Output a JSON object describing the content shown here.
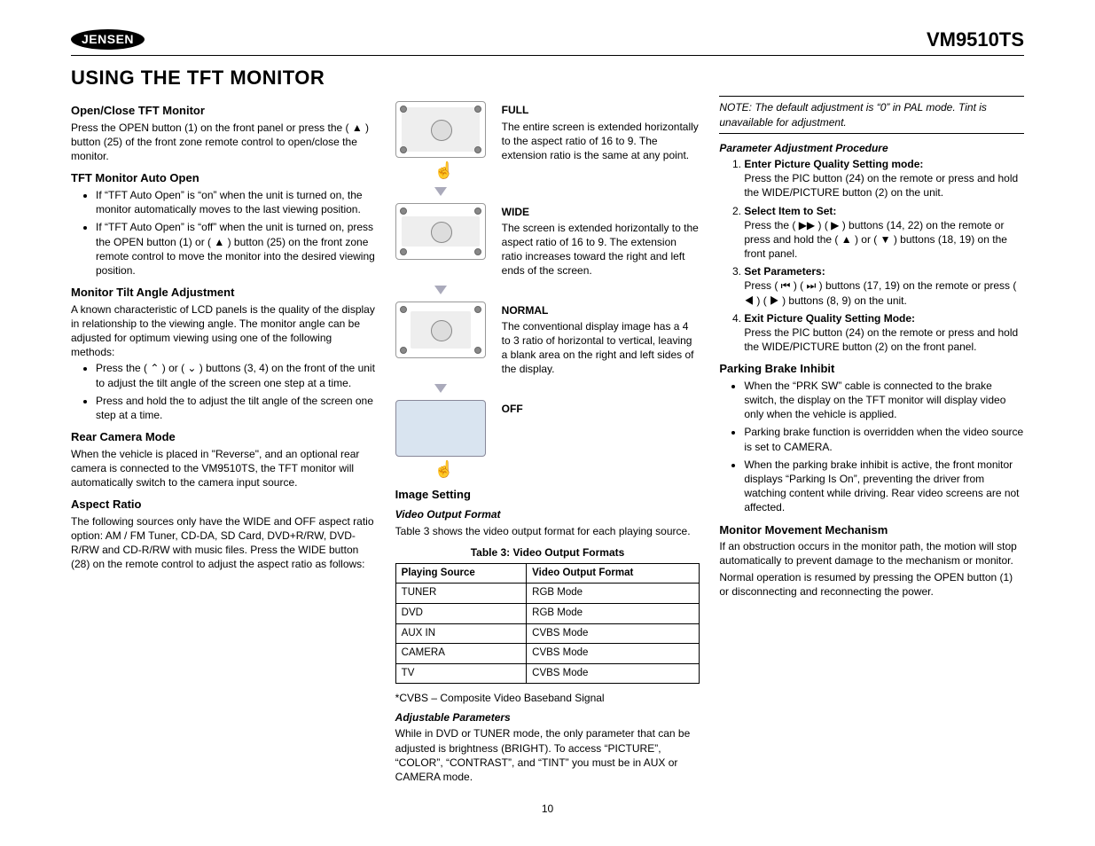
{
  "header": {
    "brand": "JENSEN",
    "model": "VM9510TS"
  },
  "title": "USING THE TFT MONITOR",
  "page_number": "10",
  "col1": {
    "open_close_h": "Open/Close TFT Monitor",
    "open_close_p": "Press the OPEN button (1) on the front panel or press the ( ▲ ) button (25) of the front zone remote control to open/close the monitor.",
    "auto_open_h": "TFT Monitor Auto Open",
    "auto_open_li1": "If “TFT Auto Open” is “on” when the unit is turned on, the monitor automatically moves to the last viewing position.",
    "auto_open_li2": "If “TFT Auto Open” is “off” when the unit is turned on, press the OPEN button (1) or ( ▲ ) button (25) on the front zone remote control to move the monitor into the desired viewing position.",
    "tilt_h": "Monitor Tilt Angle Adjustment",
    "tilt_p": "A known characteristic of LCD panels is the quality of the display in relationship to the viewing angle. The monitor angle can be adjusted for optimum viewing using one of the following methods:",
    "tilt_li1": "Press the ( ⌃ ) or ( ⌄ ) buttons (3, 4) on the front of the unit to adjust the tilt angle of the screen one step at a time.",
    "tilt_li2": "Press and hold the to adjust the tilt angle of the screen one step at a time.",
    "rear_h": "Rear Camera Mode",
    "rear_p": "When the vehicle is placed in \"Reverse\", and an optional rear camera is connected to the VM9510TS, the TFT monitor will automatically switch to the camera input source.",
    "aspect_h": "Aspect Ratio",
    "aspect_p": "The following sources only have the WIDE and OFF aspect ratio option: AM / FM Tuner, CD-DA, SD Card, DVD+R/RW, DVD-R/RW and CD-R/RW with music files. Press the WIDE button (28) on the remote control to adjust the aspect ratio as follows:"
  },
  "col2": {
    "full_h": "FULL",
    "full_p": "The entire screen is extended horizontally to the aspect ratio of 16 to 9. The extension ratio is the same at any point.",
    "wide_h": "WIDE",
    "wide_p": "The screen is extended horizontally to the aspect ratio of 16 to 9. The extension ratio increases toward the right and left ends of the screen.",
    "normal_h": "NORMAL",
    "normal_p": "The conventional display image has a 4 to 3 ratio of horizontal to vertical, leaving a blank area on the right and left sides of the display.",
    "off_h": "OFF",
    "image_setting_h": "Image Setting",
    "vof_h": "Video Output Format",
    "vof_p": "Table 3 shows the video output format for each playing source.",
    "tbl_caption": "Table 3: Video Output Formats",
    "tbl_th1": "Playing Source",
    "tbl_th2": "Video Output Format",
    "tbl": [
      {
        "src": "TUNER",
        "fmt": "RGB Mode"
      },
      {
        "src": "DVD",
        "fmt": "RGB Mode"
      },
      {
        "src": "AUX IN",
        "fmt": "CVBS Mode"
      },
      {
        "src": "CAMERA",
        "fmt": "CVBS Mode"
      },
      {
        "src": "TV",
        "fmt": "CVBS Mode"
      }
    ],
    "cvbs_note": "*CVBS – Composite Video Baseband Signal",
    "adj_params_h": "Adjustable Parameters",
    "adj_params_p": "While in DVD or TUNER mode, the only parameter that can be adjusted is brightness (BRIGHT). To access “PICTURE”, “COLOR”, “CONTRAST”, and “TINT” you must be in AUX or CAMERA mode."
  },
  "col3": {
    "note": "NOTE: The default adjustment is “0” in PAL mode. Tint is unavailable for adjustment.",
    "pap_h": "Parameter Adjustment Procedure",
    "step1_h": "Enter Picture Quality Setting mode:",
    "step1_p": "Press the PIC button (24) on the remote or press and hold the WIDE/PICTURE button (2) on the unit.",
    "step2_h": "Select Item to Set:",
    "step2_p": "Press the ( ▶▶ ) ( ▶ ) buttons (14, 22) on the remote or press and hold the ( ▲ ) or ( ▼ ) buttons (18, 19) on the front panel.",
    "step3_h": "Set Parameters:",
    "step3_p": "Press ( ⏮ ) ( ⏭ ) buttons (17, 19) on the remote or press ( ◀ ) ( ▶ ) buttons (8, 9) on the unit.",
    "step4_h": "Exit Picture Quality Setting Mode:",
    "step4_p": "Press the PIC button (24) on the remote or press and hold the WIDE/PICTURE button (2) on the front panel.",
    "pbi_h": "Parking Brake Inhibit",
    "pbi_li1": "When the “PRK SW” cable is connected to the brake switch, the display on the TFT monitor will display video only when the vehicle is applied.",
    "pbi_li2": "Parking brake function is overridden when the video source is set to CAMERA.",
    "pbi_li3": "When the parking brake inhibit is active, the front monitor displays “Parking Is On”, preventing the driver from watching content while driving. Rear video screens are not affected.",
    "mmm_h": "Monitor Movement Mechanism",
    "mmm_p1": "If an obstruction occurs in the monitor path, the motion will stop automatically to prevent damage to the mechanism or monitor.",
    "mmm_p2": "Normal operation is resumed by pressing the OPEN button (1) or disconnecting and reconnecting the power."
  }
}
